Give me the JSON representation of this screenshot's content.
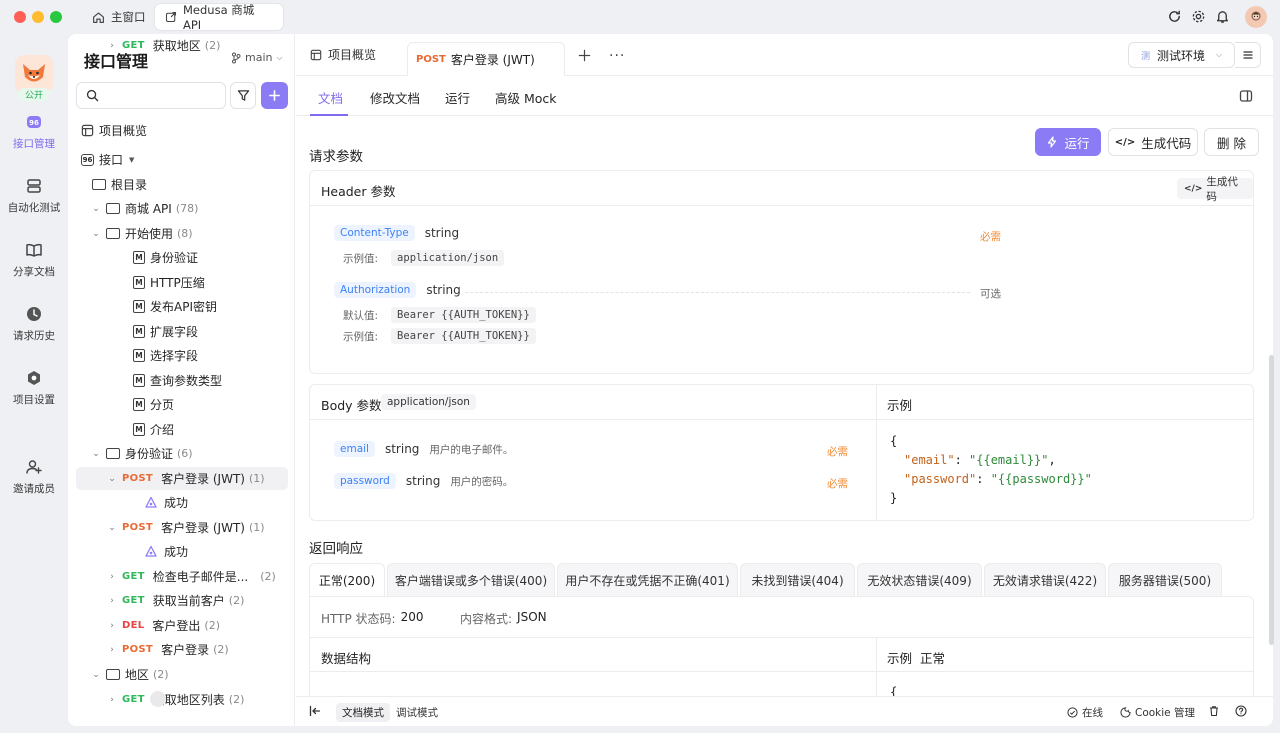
{
  "window": {
    "tabs": [
      {
        "label": "主窗口",
        "icon": "home-icon"
      },
      {
        "label": "Medusa 商城 API",
        "icon": "external-link-icon"
      }
    ],
    "right_icons": [
      "refresh-icon",
      "settings-icon",
      "bell-icon",
      "avatar"
    ]
  },
  "rail": {
    "project_badge": "公开",
    "items": [
      {
        "label": "接口管理",
        "icon": "api-icon",
        "active": true
      },
      {
        "label": "自动化测试",
        "icon": "automation-icon"
      },
      {
        "label": "分享文档",
        "icon": "book-icon"
      },
      {
        "label": "请求历史",
        "icon": "clock-icon"
      },
      {
        "label": "项目设置",
        "icon": "settings-hex-icon"
      },
      {
        "label": "邀请成员",
        "icon": "add-user-icon"
      }
    ]
  },
  "sidebar": {
    "title": "接口管理",
    "branch": "main",
    "search_placeholder": "",
    "overview": "项目概览",
    "api_label": "接口",
    "tree": [
      {
        "label": "根目录",
        "kind": "root",
        "indent": 0
      },
      {
        "label": "商城 API",
        "count": "(78)",
        "kind": "folder",
        "indent": 0,
        "expanded": true
      },
      {
        "label": "开始使用",
        "count": "(8)",
        "kind": "folder",
        "indent": 1,
        "expanded": true
      },
      {
        "label": "身份验证",
        "kind": "doc",
        "indent": 2
      },
      {
        "label": "HTTP压缩",
        "kind": "doc",
        "indent": 2
      },
      {
        "label": "发布API密钥",
        "kind": "doc",
        "indent": 2
      },
      {
        "label": "扩展字段",
        "kind": "doc",
        "indent": 2
      },
      {
        "label": "选择字段",
        "kind": "doc",
        "indent": 2
      },
      {
        "label": "查询参数类型",
        "kind": "doc",
        "indent": 2
      },
      {
        "label": "分页",
        "kind": "doc",
        "indent": 2
      },
      {
        "label": "介绍",
        "kind": "doc",
        "indent": 2
      },
      {
        "label": "身份验证",
        "count": "(6)",
        "kind": "folder",
        "indent": 1,
        "expanded": true
      },
      {
        "label": "客户登录 (JWT)",
        "count": "(1)",
        "kind": "api",
        "method": "POST",
        "indent": 2,
        "expanded": true,
        "selected": true
      },
      {
        "label": "成功",
        "kind": "case",
        "indent": 3
      },
      {
        "label": "客户登录 (JWT)",
        "count": "(1)",
        "kind": "api",
        "method": "POST",
        "indent": 2,
        "expanded": true
      },
      {
        "label": "成功",
        "kind": "case",
        "indent": 3
      },
      {
        "label": "检查电子邮件是...",
        "count": "(2)",
        "kind": "api",
        "method": "GET",
        "indent": 2
      },
      {
        "label": "获取当前客户",
        "count": "(2)",
        "kind": "api",
        "method": "GET",
        "indent": 2
      },
      {
        "label": "客户登出",
        "count": "(2)",
        "kind": "api",
        "method": "DEL",
        "indent": 2
      },
      {
        "label": "客户登录",
        "count": "(2)",
        "kind": "api",
        "method": "POST",
        "indent": 2
      },
      {
        "label": "地区",
        "count": "(2)",
        "kind": "folder",
        "indent": 1,
        "expanded": true
      },
      {
        "label": "获取地区列表",
        "count": "(2)",
        "kind": "api",
        "method": "GET",
        "indent": 2
      },
      {
        "label": "获取地区",
        "count": "(2)",
        "kind": "api",
        "method": "GET",
        "indent": 2
      }
    ]
  },
  "header": {
    "tab_overview": "项目概览",
    "active_method": "POST",
    "active_tab": "客户登录 (JWT)",
    "env_prefix": "测",
    "env": "测试环境"
  },
  "subtabs": [
    "文档",
    "修改文档",
    "运行",
    "高级 Mock"
  ],
  "doc": {
    "request_params": "请求参数",
    "run_btn": "运行",
    "gen_code_btn": "生成代码",
    "delete_btn": "删 除",
    "header_params": "Header 参数",
    "header_gen_code": "生成代码",
    "headers": [
      {
        "name": "Content-Type",
        "type": "string",
        "required": "必需",
        "rows": [
          {
            "label": "示例值:",
            "value": "application/json"
          }
        ]
      },
      {
        "name": "Authorization",
        "type": "string",
        "required": "可选",
        "rows": [
          {
            "label": "默认值:",
            "value": "Bearer {{AUTH_TOKEN}}"
          },
          {
            "label": "示例值:",
            "value": "Bearer {{AUTH_TOKEN}}"
          }
        ]
      }
    ],
    "body_params": "Body 参数",
    "body_type": "application/json",
    "example": "示例",
    "body_fields": [
      {
        "name": "email",
        "type": "string",
        "desc": "用户的电子邮件。",
        "required": "必需"
      },
      {
        "name": "password",
        "type": "string",
        "desc": "用户的密码。",
        "required": "必需"
      }
    ],
    "example_lines": [
      "{",
      "\"email\"",
      ": ",
      "\"{{email}}\"",
      "\"password\"",
      "\"{{password}}\"",
      "}"
    ],
    "responses_title": "返回响应",
    "response_tabs": [
      "正常(200)",
      "客户端错误或多个错误(400)",
      "用户不存在或凭据不正确(401)",
      "未找到错误(404)",
      "无效状态错误(409)",
      "无效请求错误(422)",
      "服务器错误(500)"
    ],
    "http_status_label": "HTTP 状态码:",
    "http_status": "200",
    "content_format_label": "内容格式:",
    "content_format": "JSON",
    "data_structure": "数据结构",
    "example_normal_label": "示例",
    "example_normal": "正常",
    "example_normal_first": "{"
  },
  "footer": {
    "doc_mode": "文档模式",
    "debug_mode": "调试模式",
    "online": "在线",
    "cookie": "Cookie 管理"
  },
  "colors": {
    "accent": "#8b7cf6",
    "post": "#ea6a35",
    "get": "#2db85c",
    "del": "#e54545",
    "required": "#f08b35"
  }
}
